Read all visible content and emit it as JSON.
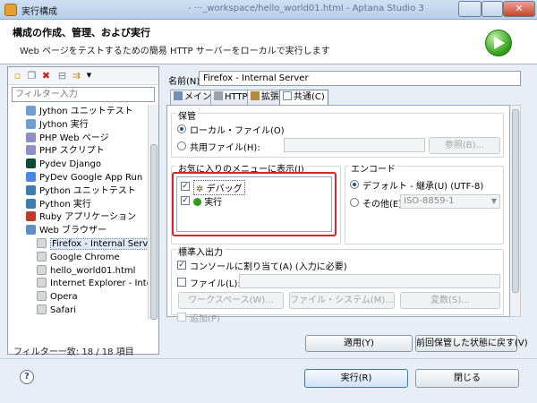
{
  "window": {
    "title": "実行構成",
    "blurred_title": "- ···_workspace/hello_world01.html - Aptana Studio 3"
  },
  "header": {
    "title": "構成の作成、管理、および実行",
    "description": "Web ページをテストするための簡易 HTTP サーバーをローカルで実行します"
  },
  "left_panel": {
    "filter_placeholder": "フィルター入力",
    "tree_items": [
      {
        "label": "Jython ユニットテスト",
        "icon_color": "#6f9fd0",
        "indent": 1
      },
      {
        "label": "Jython 実行",
        "icon_color": "#6f9fd0",
        "indent": 1
      },
      {
        "label": "PHP Web ページ",
        "icon_color": "#8c8fc8",
        "indent": 1
      },
      {
        "label": "PHP スクリプト",
        "icon_color": "#8c8fc8",
        "indent": 1
      },
      {
        "label": "Pydev Django",
        "icon_color": "#0c4b33",
        "indent": 1
      },
      {
        "label": "PyDev Google App Run",
        "icon_color": "#4a86e8",
        "indent": 1
      },
      {
        "label": "Python ユニットテスト",
        "icon_color": "#3e7cb1",
        "indent": 1
      },
      {
        "label": "Python 実行",
        "icon_color": "#3e7cb1",
        "indent": 1
      },
      {
        "label": "Ruby アプリケーション",
        "icon_color": "#c0392b",
        "indent": 1
      },
      {
        "label": "Web ブラウザー",
        "icon_color": "#5d8fc9",
        "indent": 1
      },
      {
        "label": "Firefox - Internal Server",
        "icon_color": "#d8d8d8",
        "indent": 2,
        "selected": true
      },
      {
        "label": "Google Chrome",
        "icon_color": "#d8d8d8",
        "indent": 2
      },
      {
        "label": "hello_world01.html",
        "icon_color": "#d8d8d8",
        "indent": 2
      },
      {
        "label": "Internet Explorer - Interna",
        "icon_color": "#d8d8d8",
        "indent": 2
      },
      {
        "label": "Opera",
        "icon_color": "#d8d8d8",
        "indent": 2
      },
      {
        "label": "Safari",
        "icon_color": "#d8d8d8",
        "indent": 2
      }
    ],
    "filter_count": "フィルター一致: 18 / 18 項目"
  },
  "right_panel": {
    "name_label": "名前(N):",
    "name_value": "Firefox - Internal Server",
    "tabs": [
      {
        "label": "メイン",
        "active": false
      },
      {
        "label": "HTTP",
        "active": false
      },
      {
        "label": "拡張",
        "active": false
      },
      {
        "label": "共通(C)",
        "active": true
      }
    ],
    "save": {
      "label": "保管",
      "local": "ローカル・ファイル(O)",
      "shared": "共用ファイル(H):",
      "browse": "参照(B)..."
    },
    "favorites": {
      "label": "お気に入りのメニューに表示(I)",
      "items": [
        {
          "label": "デバッグ",
          "checked": true
        },
        {
          "label": "実行",
          "checked": true
        }
      ]
    },
    "encoding": {
      "label": "エンコード",
      "default": "デフォルト - 継承(U) (UTF-8)",
      "other": "その他(E)",
      "other_value": "ISO-8859-1"
    },
    "stdio": {
      "label": "標準入出力",
      "console": "コンソールに割り当て(A) (入力に必要)",
      "file": "ファイル(L):",
      "workspace": "ワークスペース(W)...",
      "filesystem": "ファイル・システム(M)...",
      "variables": "変数(S)...",
      "append": "追加(P)"
    },
    "apply": "適用(Y)",
    "revert": "前回保管した状態に戻す(V)"
  },
  "footer": {
    "run": "実行(R)",
    "close": "閉じる"
  },
  "colors": {
    "highlight": "#d8242a",
    "run_green": "#2e9c16"
  }
}
